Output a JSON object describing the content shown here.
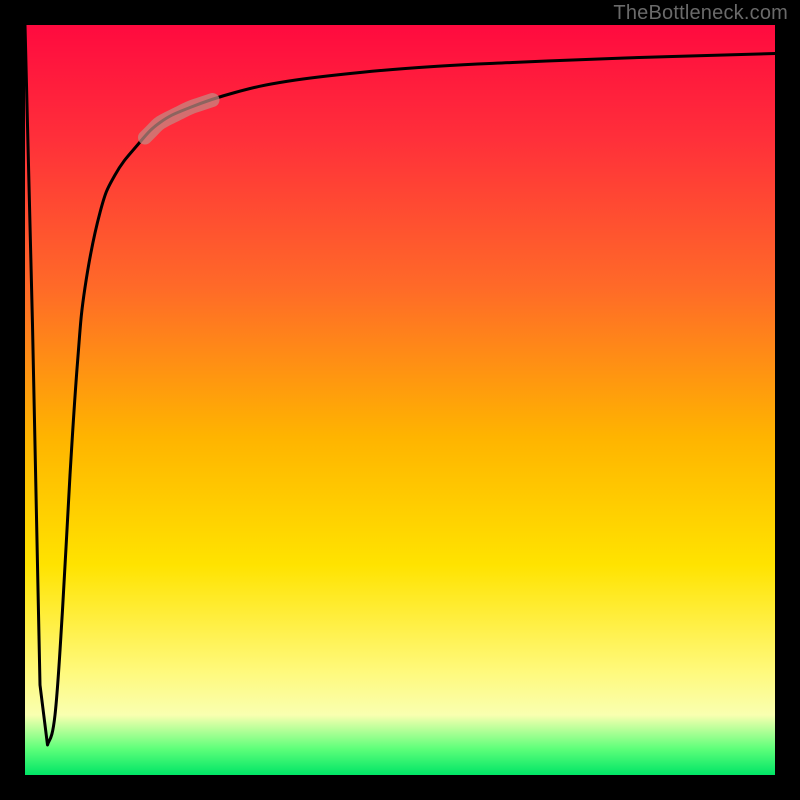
{
  "watermark": "TheBottleneck.com",
  "colors": {
    "frame": "#000000",
    "gradient_top": "#ff0a3f",
    "gradient_mid": "#ffe300",
    "gradient_bottom": "#00e566",
    "curve": "#000000",
    "highlight": "#c48a84"
  },
  "chart_data": {
    "type": "line",
    "title": "",
    "xlabel": "",
    "ylabel": "",
    "xlim": [
      0,
      100
    ],
    "ylim": [
      0,
      100
    ],
    "series": [
      {
        "name": "curve",
        "x": [
          0,
          1,
          2,
          3,
          4,
          5,
          6,
          7,
          8,
          10,
          12,
          15,
          18,
          22,
          28,
          35,
          45,
          55,
          65,
          80,
          100
        ],
        "y": [
          100,
          60,
          12,
          4,
          8,
          22,
          40,
          55,
          65,
          75,
          80,
          84,
          87,
          89,
          91,
          92.5,
          93.7,
          94.5,
          95,
          95.6,
          96.2
        ]
      }
    ],
    "highlight_range_x": [
      16,
      25
    ],
    "annotations": []
  }
}
